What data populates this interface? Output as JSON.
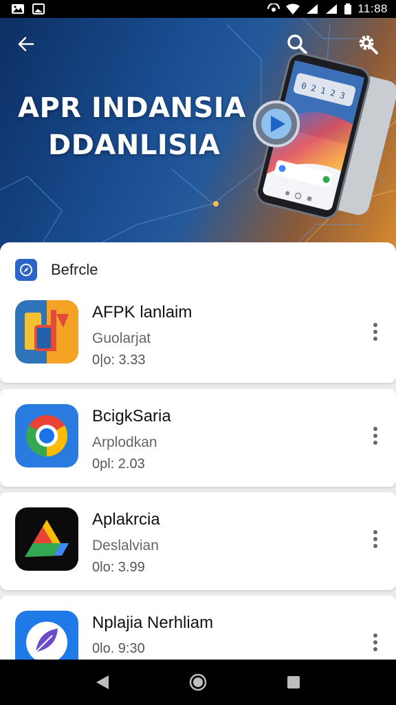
{
  "status_bar": {
    "time": "11:88",
    "icons": [
      "gallery-icon",
      "image-icon",
      "hotspot-icon",
      "wifi-icon",
      "signal-icon",
      "signal-icon",
      "battery-icon"
    ]
  },
  "hero": {
    "title_line1": "APR INDANSIA",
    "title_line2": "DDANLISIA",
    "phone_screen_text": "0 2 1 2 3",
    "icons": [
      "back-arrow-icon",
      "search-icon",
      "settings-icon"
    ]
  },
  "section": {
    "label": "Befrcle",
    "icon": "compass-globe-icon"
  },
  "apps": [
    {
      "name": "AFPK lanlaim",
      "subtitle": "Guolarjat",
      "size": "0|o: 3.33",
      "icon": "colorful-blocks-app-icon"
    },
    {
      "name": "BcigkSaria",
      "subtitle": "Arplodkan",
      "size": "0pl: 2.03",
      "icon": "chrome-browser-icon"
    },
    {
      "name": "Aplakrcia",
      "subtitle": "Deslalvian",
      "size": "0lo: 3.99",
      "icon": "google-drive-icon"
    },
    {
      "name": "Nplajia Nerhliam",
      "subtitle": "",
      "size": "0lo. 9:30",
      "icon": "leaf-app-icon"
    }
  ],
  "nav": {
    "icons": [
      "back-triangle-icon",
      "home-circle-icon",
      "recents-square-icon"
    ]
  },
  "colors": {
    "accent_blue": "#2c64c8",
    "hero_dark": "#0d2f63",
    "hero_orange": "#d98a2e"
  }
}
